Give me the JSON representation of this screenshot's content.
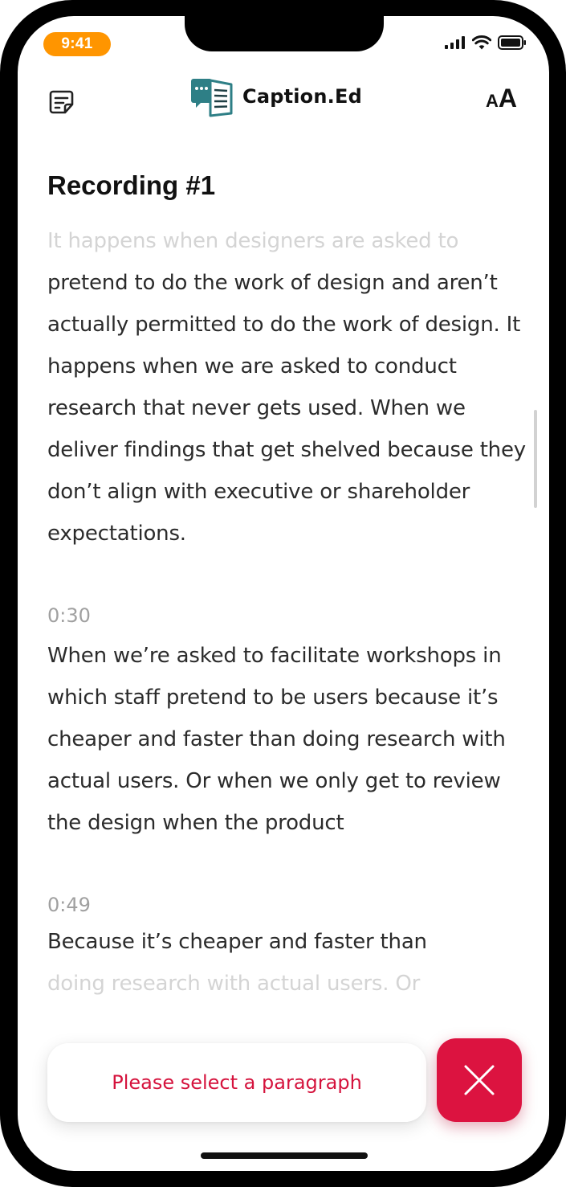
{
  "status_bar": {
    "time": "9:41"
  },
  "header": {
    "app_name": "Caption.Ed",
    "font_size_label_small": "A",
    "font_size_label_large": "A",
    "note_icon": "note-edit-icon"
  },
  "transcript": {
    "title": "Recording #1",
    "paragraphs": [
      {
        "timestamp": "",
        "faded_line": "It happens when designers are asked to",
        "text": "pretend to do the work of design and aren’t actually permitted to do the work of design. It happens when we are asked to conduct research that never gets used. When we deliver findings that get shelved because they don’t align with executive or shareholder expectations."
      },
      {
        "timestamp": "0:30",
        "text": "When we’re asked to facilitate workshops in which staff pretend to be users because it’s cheaper and faster than doing research with actual users. Or when we only get to review the design when the product"
      },
      {
        "timestamp": "0:49",
        "text": "Because it’s cheaper and faster than",
        "faded_line": "doing research with actual users. Or"
      }
    ]
  },
  "toast": {
    "message": "Please select a paragraph"
  },
  "colors": {
    "accent": "#DC1340",
    "time_pill": "#FF9500",
    "logo_teal": "#2E7F86"
  }
}
